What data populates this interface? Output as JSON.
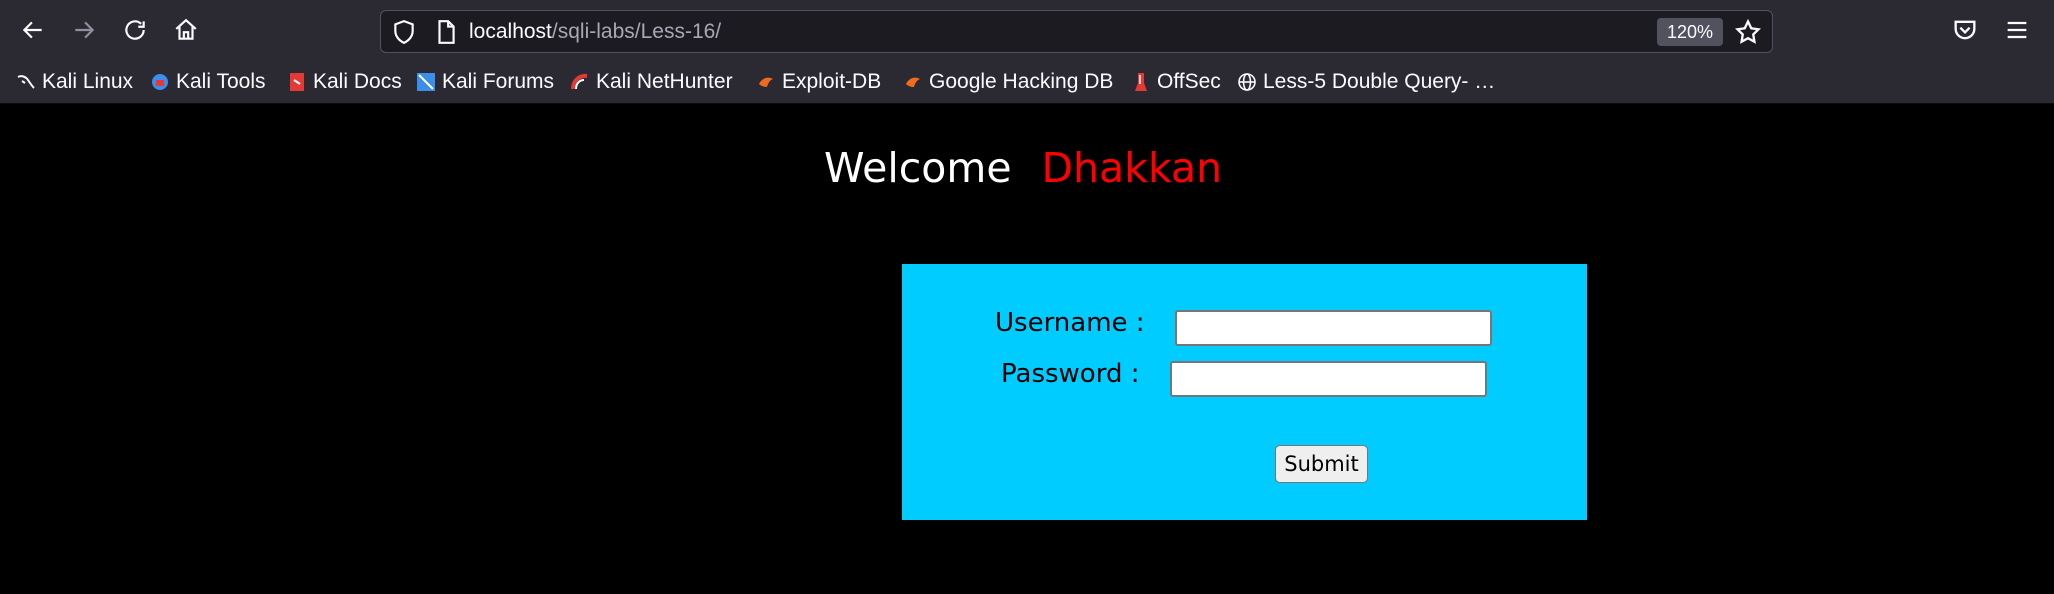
{
  "browser": {
    "url_host": "localhost",
    "url_path": "/sqli-labs/Less-16/",
    "zoom": "120%",
    "nav_icons": [
      "back-arrow-icon",
      "forward-arrow-icon",
      "reload-icon",
      "home-icon"
    ],
    "right_icons": [
      "pocket-icon",
      "menu-icon"
    ]
  },
  "bookmarks": [
    {
      "label": "Kali Linux",
      "icon": "kali-dragon-icon",
      "color": "#fbfbfe"
    },
    {
      "label": "Kali Tools",
      "icon": "kali-tools-icon",
      "color": "#3b8eea"
    },
    {
      "label": "Kali Docs",
      "icon": "kali-docs-icon",
      "color": "#e53935"
    },
    {
      "label": "Kali Forums",
      "icon": "kali-forums-icon",
      "color": "#3b8eea"
    },
    {
      "label": "Kali NetHunter",
      "icon": "kali-nethunter-icon",
      "color": "#e53935"
    },
    {
      "label": "Exploit-DB",
      "icon": "exploit-db-icon",
      "color": "#f26a1b"
    },
    {
      "label": "Google Hacking DB",
      "icon": "ghdb-icon",
      "color": "#f26a1b"
    },
    {
      "label": "OffSec",
      "icon": "offsec-icon",
      "color": "#e53935"
    },
    {
      "label": "Less-5 Double Query- …",
      "icon": "globe-icon",
      "color": "#fbfbfe"
    }
  ],
  "page": {
    "welcome": "Welcome",
    "name": "Dhakkan",
    "username_label": "Username :",
    "password_label": "Password :",
    "username_value": "",
    "password_value": "",
    "submit_label": "Submit"
  },
  "colors": {
    "form_background": "#00ccff",
    "name_color": "#ff0000",
    "page_background": "#000000"
  }
}
